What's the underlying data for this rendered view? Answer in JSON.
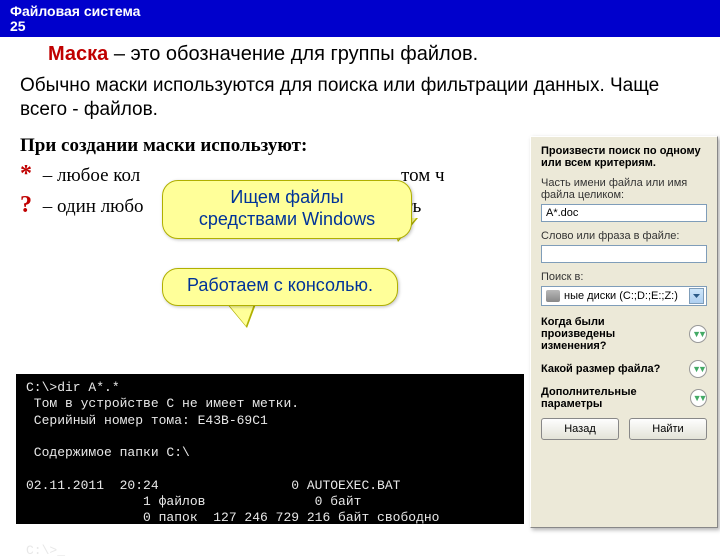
{
  "titlebar": {
    "line1": "Файловая система",
    "line2": "25"
  },
  "heading": {
    "term": "Маска",
    "rest": " – это обозначение для группы файлов."
  },
  "para1": "Обычно маски используются для поиска или фильтрации данных. Чаще всего - файлов.",
  "mask": {
    "intro": "При создании маски используют:",
    "star_sym": "*",
    "star_text": " – любое кол",
    "star_tail": "том ч",
    "q_sym": "?",
    "q_text": " – один любо",
    "q_tail": "ть"
  },
  "callouts": {
    "top": "Ищем файлы средствами Windows",
    "bot": "Работаем с консолью."
  },
  "console_text": "C:\\>dir A*.*\n Том в устройстве C не имеет метки.\n Серийный номер тома: E43B-69C1\n\n Содержимое папки C:\\\n\n02.11.2011  20:24                 0 AUTOEXEC.BAT\n               1 файлов              0 байт\n               0 папок  127 246 729 216 байт свободно\n\nC:\\>_",
  "search": {
    "head": "Произвести поиск по одному или всем критериям.",
    "name_label": "Часть имени файла или имя файла целиком:",
    "name_value": "A*.doc",
    "word_label": "Слово или фраза в файле:",
    "word_value": "",
    "in_label": "Поиск в:",
    "in_value": "ные диски (C:;D:;E:;Z:)",
    "when_label": "Когда были произведены изменения?",
    "size_label": "Какой размер файла?",
    "more_label": "Дополнительные параметры",
    "back": "Назад",
    "find": "Найти"
  }
}
